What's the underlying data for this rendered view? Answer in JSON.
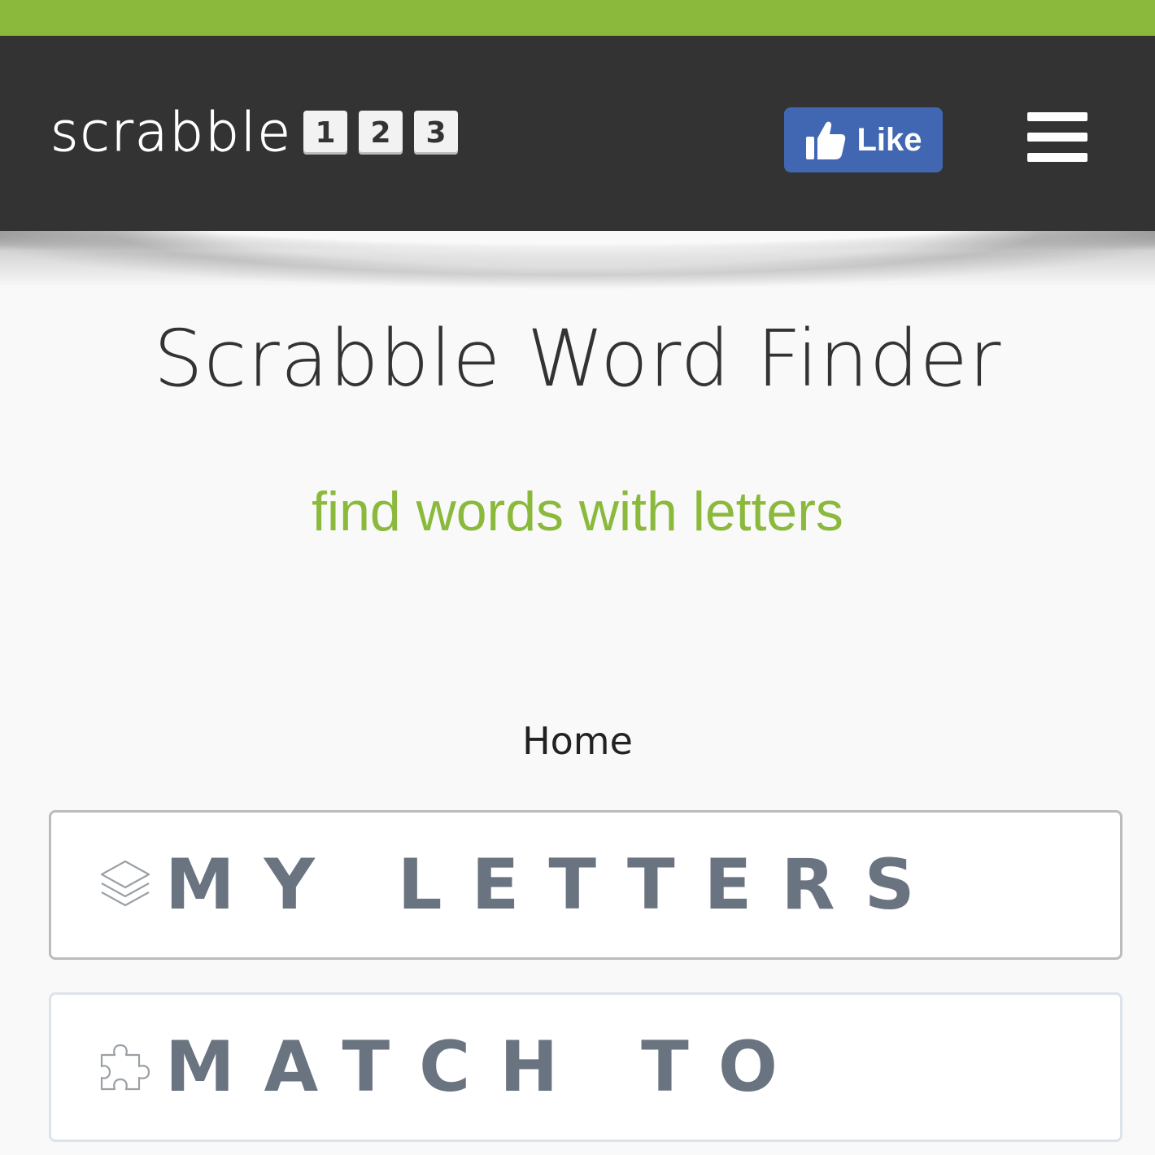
{
  "header": {
    "logo_text": "scrabble",
    "logo_tiles": [
      "1",
      "2",
      "3"
    ],
    "like_label": "Like",
    "menu_icon": "hamburger-menu-icon"
  },
  "main": {
    "title": "Scrabble Word Finder",
    "subtitle": "find words with letters",
    "breadcrumb": "Home",
    "panels": [
      {
        "label": "MY LETTERS",
        "icon": "layers-icon"
      },
      {
        "label": "MATCH TO",
        "icon": "puzzle-icon"
      }
    ]
  },
  "colors": {
    "accent_green": "#8bb93c",
    "header_bg": "#333333",
    "facebook_blue": "#4267b2",
    "panel_text": "#6a7480"
  }
}
